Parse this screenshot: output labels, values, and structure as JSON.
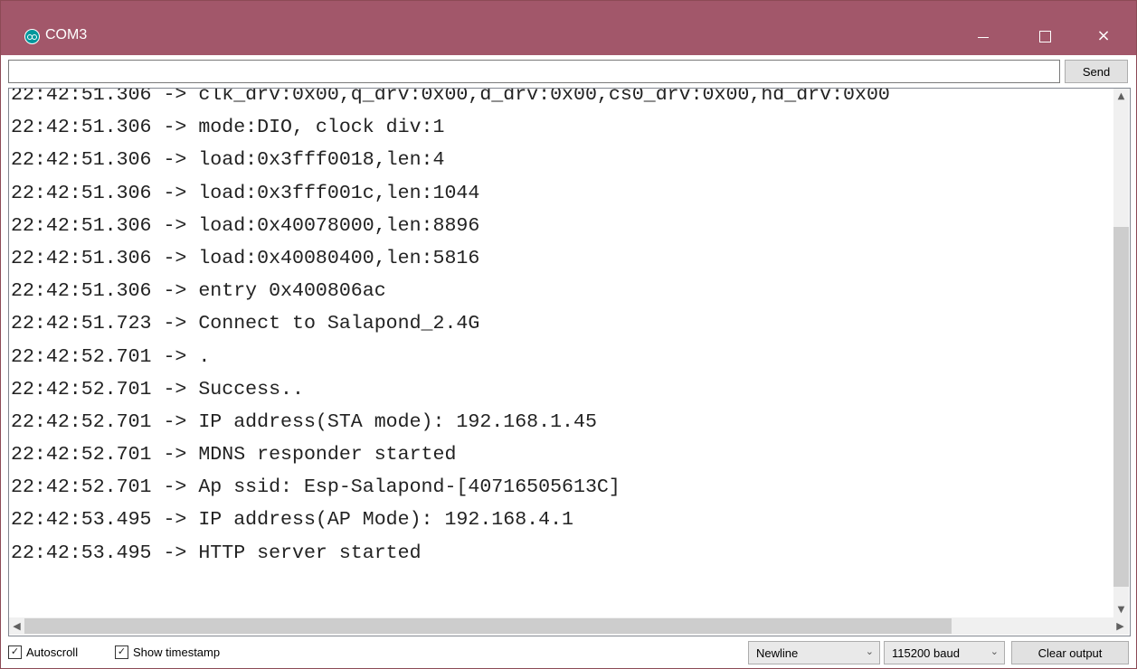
{
  "window": {
    "title": "COM3",
    "app_icon": "arduino-icon",
    "minimize_icon": "minimize-icon",
    "maximize_icon": "maximize-icon",
    "close_icon": "close-icon",
    "close_glyph": "×",
    "accent_color": "#a2576a"
  },
  "input": {
    "value": "",
    "send_label": "Send"
  },
  "output": {
    "lines": [
      "22:42:51.306 -> clk_drv:0x00,q_drv:0x00,d_drv:0x00,cs0_drv:0x00,hd_drv:0x00",
      "22:42:51.306 -> mode:DIO, clock div:1",
      "22:42:51.306 -> load:0x3fff0018,len:4",
      "22:42:51.306 -> load:0x3fff001c,len:1044",
      "22:42:51.306 -> load:0x40078000,len:8896",
      "22:42:51.306 -> load:0x40080400,len:5816",
      "22:42:51.306 -> entry 0x400806ac",
      "22:42:51.723 -> Connect to Salapond_2.4G",
      "22:42:52.701 -> .",
      "22:42:52.701 -> Success..",
      "22:42:52.701 -> IP address(STA mode): 192.168.1.45",
      "22:42:52.701 -> MDNS responder started",
      "22:42:52.701 -> Ap ssid: Esp-Salapond-[40716505613C]",
      "22:42:53.495 -> IP address(AP Mode): 192.168.4.1",
      "22:42:53.495 -> HTTP server started"
    ]
  },
  "bottom": {
    "autoscroll_label": "Autoscroll",
    "autoscroll_checked": true,
    "timestamp_label": "Show timestamp",
    "timestamp_checked": true,
    "line_ending": "Newline",
    "baud": "115200 baud",
    "clear_label": "Clear output"
  }
}
